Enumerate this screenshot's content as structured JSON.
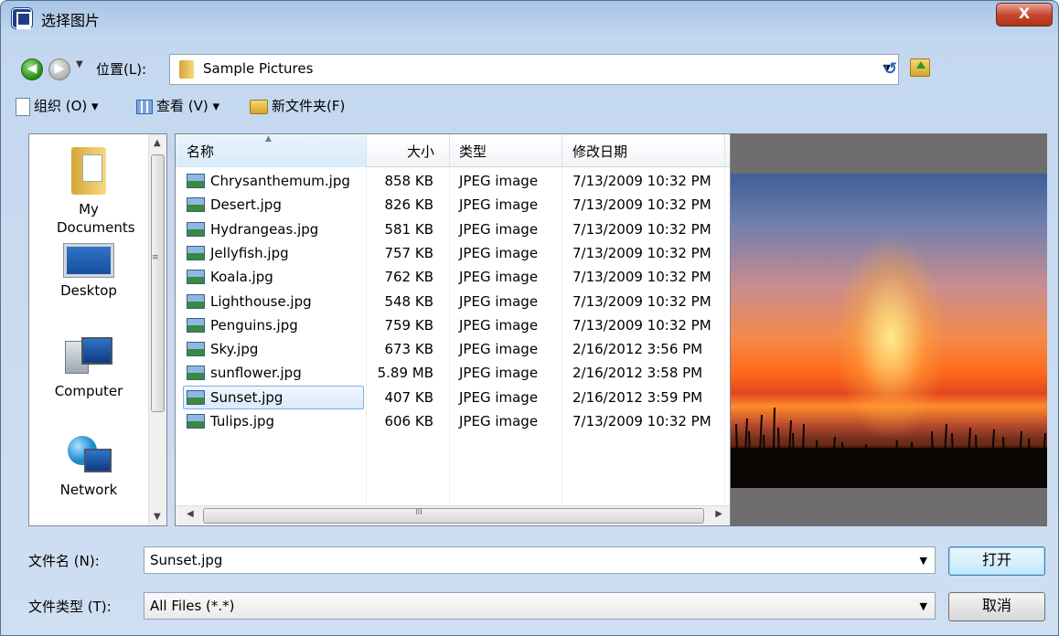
{
  "window": {
    "title": "选择图片",
    "close_label": "X"
  },
  "address": {
    "location_label": "位置(L):",
    "location_value": "Sample Pictures"
  },
  "toolbar": {
    "organize": "组织 (O) ▾",
    "view": "查看 (V) ▾",
    "new_folder": "新文件夹(F)"
  },
  "nav": {
    "items": [
      {
        "label": "My Documents",
        "icon": "documents-folder-icon"
      },
      {
        "label": "Desktop",
        "icon": "desktop-icon"
      },
      {
        "label": "Computer",
        "icon": "computer-icon"
      },
      {
        "label": "Network",
        "icon": "network-icon"
      }
    ]
  },
  "columns": {
    "name": "名称",
    "size": "大小",
    "type": "类型",
    "modified": "修改日期"
  },
  "files": [
    {
      "name": "Chrysanthemum.jpg",
      "size": "858 KB",
      "type": "JPEG image",
      "modified": "7/13/2009 10:32 PM"
    },
    {
      "name": "Desert.jpg",
      "size": "826 KB",
      "type": "JPEG image",
      "modified": "7/13/2009 10:32 PM"
    },
    {
      "name": "Hydrangeas.jpg",
      "size": "581 KB",
      "type": "JPEG image",
      "modified": "7/13/2009 10:32 PM"
    },
    {
      "name": "Jellyfish.jpg",
      "size": "757 KB",
      "type": "JPEG image",
      "modified": "7/13/2009 10:32 PM"
    },
    {
      "name": "Koala.jpg",
      "size": "762 KB",
      "type": "JPEG image",
      "modified": "7/13/2009 10:32 PM"
    },
    {
      "name": "Lighthouse.jpg",
      "size": "548 KB",
      "type": "JPEG image",
      "modified": "7/13/2009 10:32 PM"
    },
    {
      "name": "Penguins.jpg",
      "size": "759 KB",
      "type": "JPEG image",
      "modified": "7/13/2009 10:32 PM"
    },
    {
      "name": "Sky.jpg",
      "size": "673 KB",
      "type": "JPEG image",
      "modified": "2/16/2012 3:56 PM"
    },
    {
      "name": "sunflower.jpg",
      "size": "5.89 MB",
      "type": "JPEG image",
      "modified": "2/16/2012 3:58 PM"
    },
    {
      "name": "Sunset.jpg",
      "size": "407 KB",
      "type": "JPEG image",
      "modified": "2/16/2012 3:59 PM"
    },
    {
      "name": "Tulips.jpg",
      "size": "606 KB",
      "type": "JPEG image",
      "modified": "7/13/2009 10:32 PM"
    }
  ],
  "selected_file": "Sunset.jpg",
  "bottom": {
    "filename_label": "文件名 (N):",
    "filename_value": "Sunset.jpg",
    "filetype_label": "文件类型 (T):",
    "filetype_value": "All Files (*.*)",
    "open_button": "打开",
    "cancel_button": "取消"
  },
  "colors": {
    "selection": "#d9eafb",
    "selection_border": "#84acdd",
    "window_frame": "#c3d7ef"
  }
}
